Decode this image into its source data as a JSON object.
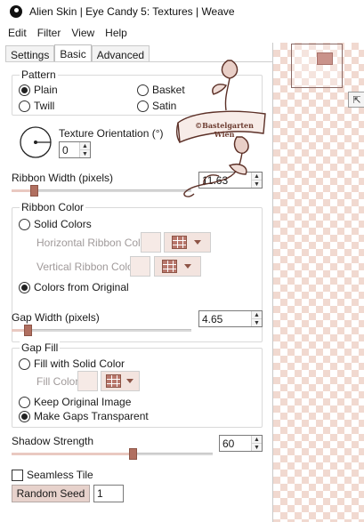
{
  "window": {
    "title": "Alien Skin | Eye Candy 5: Textures | Weave"
  },
  "menu": [
    "Edit",
    "Filter",
    "View",
    "Help"
  ],
  "tabs": [
    "Settings",
    "Basic",
    "Advanced"
  ],
  "pattern": {
    "label": "Pattern",
    "options": {
      "plain": "Plain",
      "basket": "Basket",
      "twill": "Twill",
      "satin": "Satin"
    },
    "selected": "Plain"
  },
  "texture_orientation": {
    "label": "Texture Orientation (°)",
    "value": "0"
  },
  "ribbon_width": {
    "label": "Ribbon Width (pixels)",
    "value": "11.63"
  },
  "ribbon_color": {
    "label": "Ribbon Color",
    "solid_colors": "Solid Colors",
    "horizontal": "Horizontal Ribbon Color",
    "vertical": "Vertical Ribbon Color",
    "from_original": "Colors from Original",
    "selected": "Colors from Original"
  },
  "gap_width": {
    "label": "Gap Width (pixels)",
    "value": "4.65"
  },
  "gap_fill": {
    "label": "Gap Fill",
    "fill_solid": "Fill with Solid Color",
    "fill_color": "Fill Color",
    "keep_original": "Keep Original Image",
    "transparent": "Make Gaps Transparent",
    "selected": "Make Gaps Transparent"
  },
  "shadow_strength": {
    "label": "Shadow Strength",
    "value": "60"
  },
  "seamless_tile": {
    "label": "Seamless Tile",
    "checked": false
  },
  "random_seed": {
    "button": "Random Seed",
    "value": "1"
  },
  "watermark": {
    "line1": "©Bastelgarten",
    "line2": "Wien"
  },
  "colors": {
    "accent": "#b06f60",
    "checker": "#f1d9d0",
    "swatch": "#f6eae6"
  }
}
